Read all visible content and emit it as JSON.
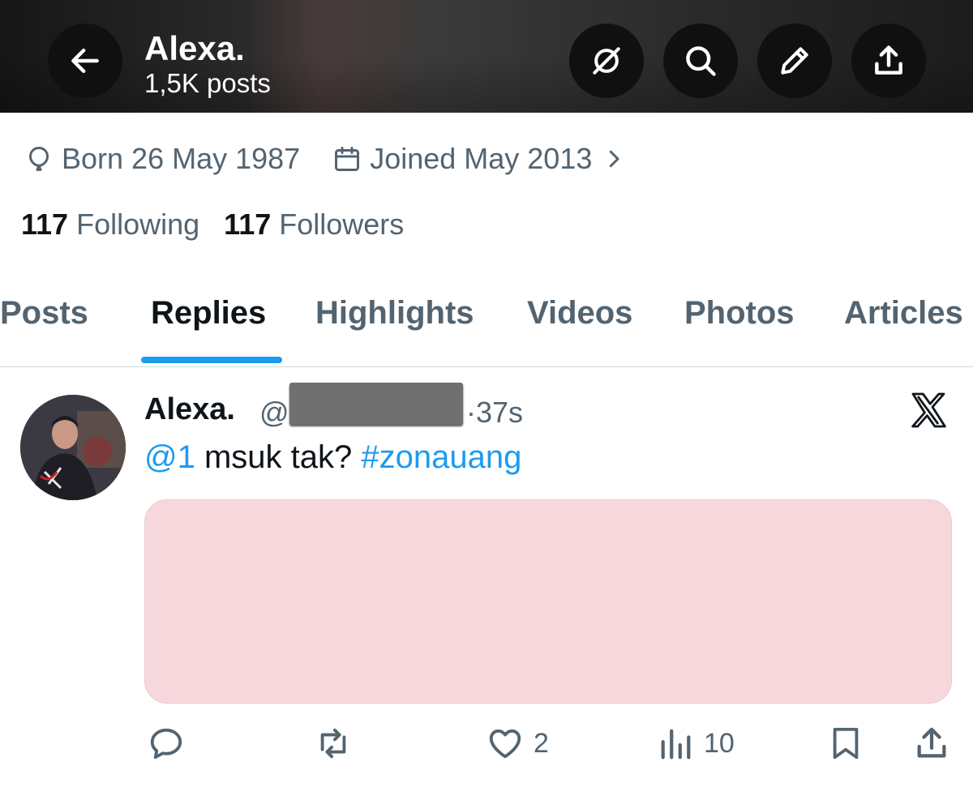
{
  "header": {
    "name": "Alexa.",
    "posts_count": "1,5K posts",
    "icons": [
      "back-arrow-icon",
      "grok-icon",
      "search-icon",
      "edit-icon",
      "share-icon"
    ]
  },
  "profile": {
    "born": "Born 26 May 1987",
    "joined": "Joined May 2013",
    "following_count": "117",
    "following_label": "Following",
    "followers_count": "117",
    "followers_label": "Followers"
  },
  "tabs": [
    {
      "label": "Posts",
      "active": false
    },
    {
      "label": "Replies",
      "active": true
    },
    {
      "label": "Highlights",
      "active": false
    },
    {
      "label": "Videos",
      "active": false
    },
    {
      "label": "Photos",
      "active": false
    },
    {
      "label": "Articles",
      "active": false
    }
  ],
  "tweet": {
    "author": "Alexa.",
    "handle_prefix": "@",
    "time": "·37s",
    "text_mention": "@1",
    "text_body": " msuk tak? ",
    "text_hashtag": "#zonauang",
    "replies": "",
    "retweets": "",
    "likes": "2",
    "views": "10"
  },
  "colors": {
    "accent": "#1d9bf0",
    "secondary_text": "#536471",
    "media_placeholder": "#f6d8dc"
  }
}
